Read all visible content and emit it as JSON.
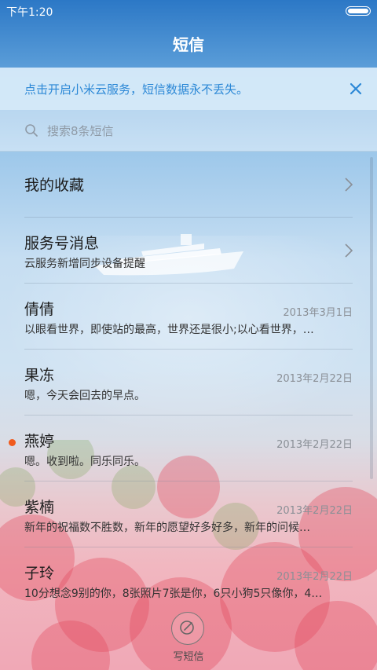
{
  "status_bar": {
    "time": "下午1:20"
  },
  "header": {
    "title": "短信"
  },
  "banner": {
    "text": "点击开启小米云服务，短信数据永不丢失。",
    "close_icon": "close-icon"
  },
  "search": {
    "placeholder": "搜索8条短信",
    "icon": "search-icon"
  },
  "threads": [
    {
      "name": "我的收藏",
      "preview": "",
      "date": "",
      "chevron": true,
      "unread": false
    },
    {
      "name": "服务号消息",
      "preview": "云服务新增同步设备提醒",
      "date": "",
      "chevron": true,
      "unread": false
    },
    {
      "name": "倩倩",
      "preview": "以眼看世界，即使站的最高，世界还是很小;以心看世界，…",
      "date": "2013年3月1日",
      "chevron": false,
      "unread": false
    },
    {
      "name": "果冻",
      "preview": "嗯，今天会回去的早点。",
      "date": "2013年2月22日",
      "chevron": false,
      "unread": false
    },
    {
      "name": "燕婷",
      "preview": "嗯。收到啦。同乐同乐。",
      "date": "2013年2月22日",
      "chevron": false,
      "unread": true
    },
    {
      "name": "紫楠",
      "preview": "新年的祝福数不胜数，新年的愿望好多好多，新年的问候…",
      "date": "2013年2月22日",
      "chevron": false,
      "unread": false
    },
    {
      "name": "子玲",
      "preview": "10分想念9别的你，8张照片7张是你，6只小狗5只像你，4…",
      "date": "2013年2月22日",
      "chevron": false,
      "unread": false
    }
  ],
  "compose": {
    "label": "写短信",
    "icon": "compose-icon"
  },
  "colors": {
    "accent": "#2c88d6",
    "unread_dot": "#f05a1d",
    "header_blue": "#2c78c6"
  }
}
